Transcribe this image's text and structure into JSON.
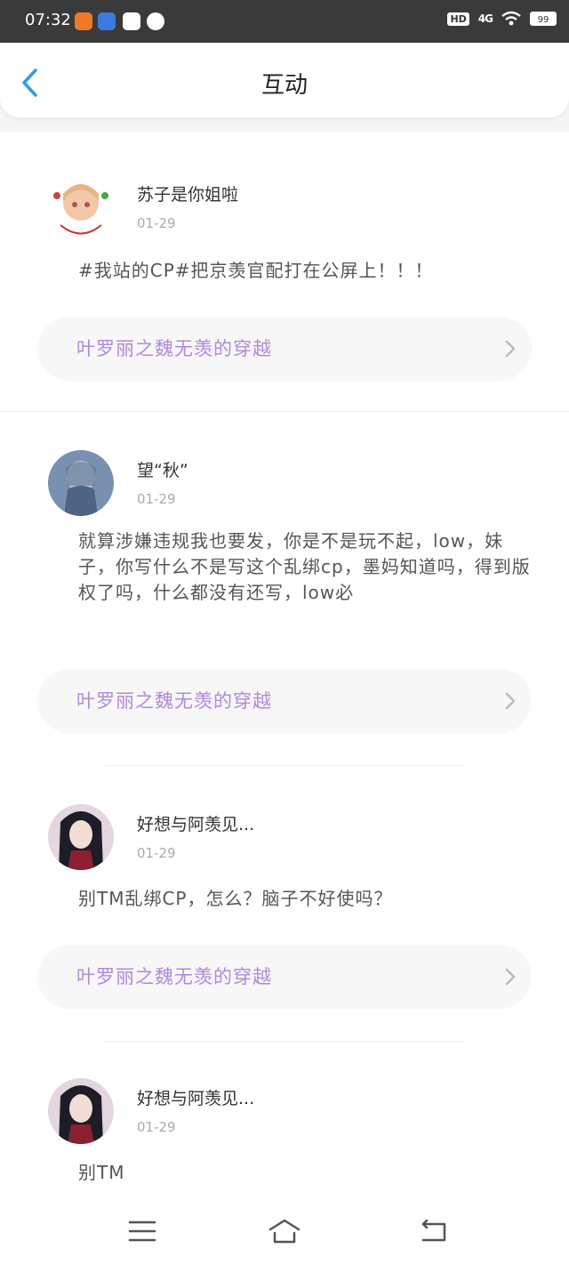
{
  "status_bar": {
    "time": "07:32",
    "hd": "HD",
    "signal": "4G",
    "battery": "99"
  },
  "header": {
    "title": "互动"
  },
  "posts": [
    {
      "username": "苏子是你姐啦",
      "date": "01-29",
      "text": "#我站的CP#把京羡官配打在公屏上！！！",
      "link": "叶罗丽之魏无羡的穿越"
    },
    {
      "username": "望“秋”",
      "date": "01-29",
      "text": "就算涉嫌违规我也要发，你是不是玩不起，low，妹子，你写什么不是写这个乱绑cp，墨妈知道吗，得到版权了吗，什么都没有还写，low必",
      "link": "叶罗丽之魏无羡的穿越"
    },
    {
      "username": "好想与阿羡见...",
      "date": "01-29",
      "text": "别TM乱绑CP，怎么？脑子不好使吗？",
      "link": "叶罗丽之魏无羡的穿越"
    },
    {
      "username": "好想与阿羡见...",
      "date": "01-29",
      "text": "别TM"
    }
  ],
  "colors": {
    "accent_blue": "#2f9be8",
    "link_purple": "#b08ad8",
    "status_bar": "#3a3a3a"
  },
  "icons": {
    "back": "chevron-left-icon",
    "link_arrow": "chevron-right-icon",
    "menu": "menu-icon",
    "home": "home-icon",
    "return": "back-icon"
  }
}
